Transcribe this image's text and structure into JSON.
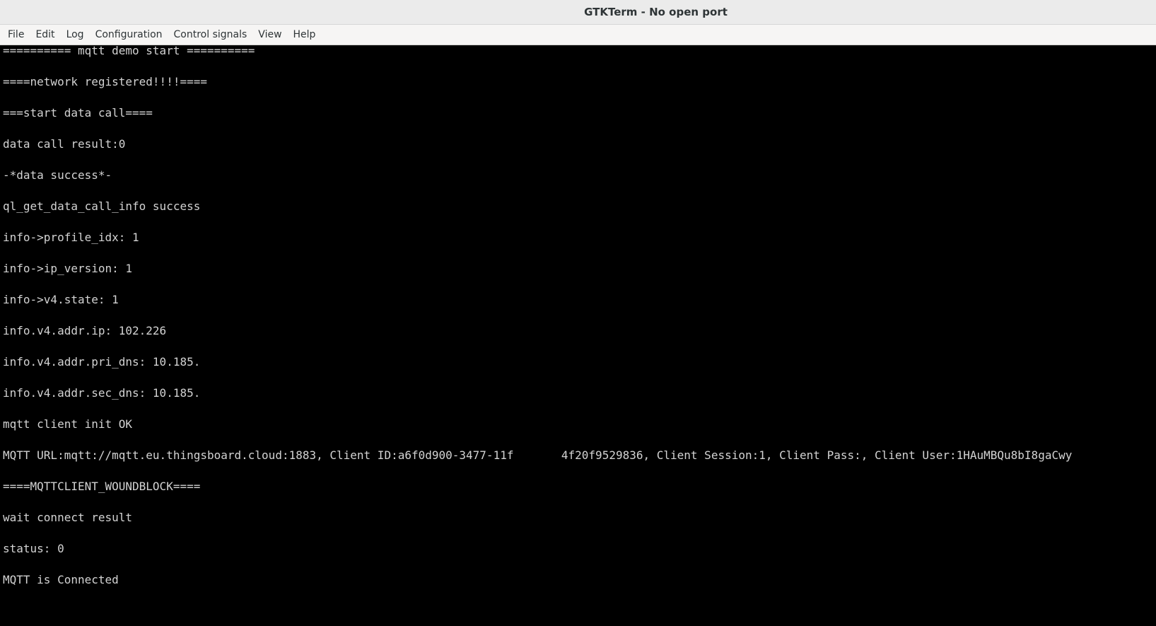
{
  "window": {
    "title": "GTKTerm - No open port"
  },
  "menubar": {
    "items": [
      {
        "label": "File"
      },
      {
        "label": "Edit"
      },
      {
        "label": "Log"
      },
      {
        "label": "Configuration"
      },
      {
        "label": "Control signals"
      },
      {
        "label": "View"
      },
      {
        "label": "Help"
      }
    ]
  },
  "terminal": {
    "background": "#000000",
    "foreground": "#d3d3d3",
    "lines": [
      "========== mqtt demo start ==========",
      "====network registered!!!!====",
      "===start data call====",
      "data call result:0",
      "-*data success*-",
      "ql_get_data_call_info success",
      "info->profile_idx: 1",
      "info->ip_version: 1",
      "info->v4.state: 1",
      "info.v4.addr.ip: 102.226",
      "info.v4.addr.pri_dns: 10.185.",
      "info.v4.addr.sec_dns: 10.185.",
      "mqtt client init OK",
      "MQTT URL:mqtt://mqtt.eu.thingsboard.cloud:1883, Client ID:a6f0d900-3477-11f       4f20f9529836, Client Session:1, Client Pass:, Client User:1HAuMBQu8bI8gaCwy",
      "====MQTTCLIENT_WOUNDBLOCK====",
      "wait connect result",
      "status: 0",
      "MQTT is Connected"
    ]
  }
}
